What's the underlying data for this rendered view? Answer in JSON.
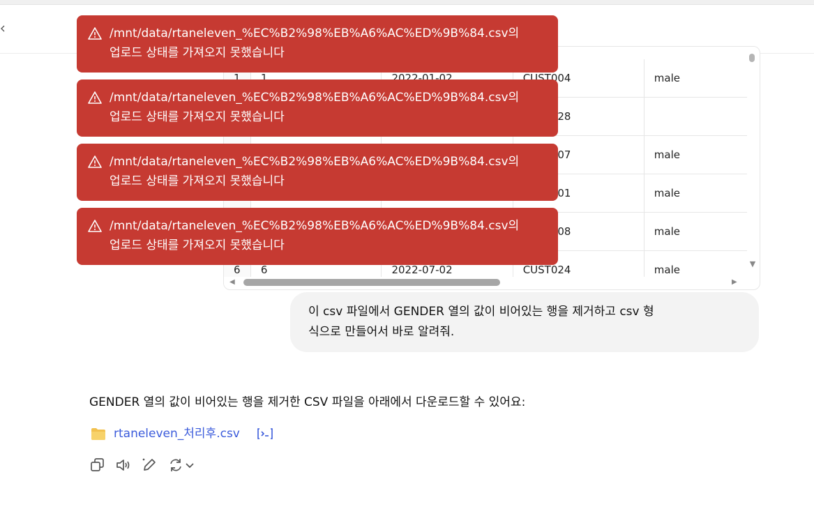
{
  "header": {
    "chevron_icon": "chevron-left-icon"
  },
  "table": {
    "rows": [
      [
        "1",
        "1",
        "2022-01-02",
        "CUST004",
        "male"
      ],
      [
        "",
        "",
        "",
        "CUST028",
        ""
      ],
      [
        "",
        "",
        "",
        "CUST007",
        "male"
      ],
      [
        "",
        "",
        "",
        "CUST001",
        "male"
      ],
      [
        "",
        "",
        "",
        "CUST008",
        "male"
      ],
      [
        "6",
        "6",
        "2022-07-02",
        "CUST024",
        "male"
      ]
    ]
  },
  "toasts": [
    {
      "line1": "/mnt/data/rtaneleven_%EC%B2%98%EB%A6%AC%ED%9B%84.csv의",
      "line2": "업로드 상태를 가져오지 못했습니다"
    },
    {
      "line1": "/mnt/data/rtaneleven_%EC%B2%98%EB%A6%AC%ED%9B%84.csv의",
      "line2": "업로드 상태를 가져오지 못했습니다"
    },
    {
      "line1": "/mnt/data/rtaneleven_%EC%B2%98%EB%A6%AC%ED%9B%84.csv의",
      "line2": "업로드 상태를 가져오지 못했습니다"
    },
    {
      "line1": "/mnt/data/rtaneleven_%EC%B2%98%EB%A6%AC%ED%9B%84.csv의",
      "line2": "업로드 상태를 가져오지 못했습니다"
    }
  ],
  "user_message": {
    "line1": "이 csv 파일에서 GENDER 열의 값이 비어있는 행을 제거하고 csv 형",
    "line2": "식으로 만들어서 바로 알려줘."
  },
  "assistant": {
    "text": "GENDER 열의 값이 비어있는 행을 제거한 CSV 파일을 아래에서 다운로드할 수 있어요:",
    "file_name": "rtaneleven_처리후.csv"
  },
  "colors": {
    "toast_bg": "#c63a32",
    "link": "#3b5bdb",
    "bubble_bg": "#f3f3f3"
  }
}
